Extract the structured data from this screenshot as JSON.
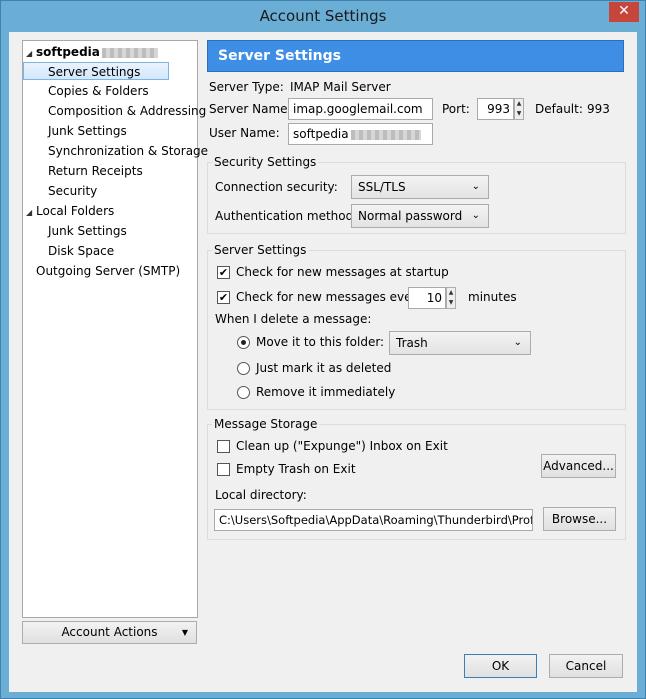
{
  "window": {
    "title": "Account Settings",
    "close_glyph": "✕"
  },
  "tree": {
    "account_name": "softpedia",
    "account_children": [
      "Server Settings",
      "Copies & Folders",
      "Composition & Addressing",
      "Junk Settings",
      "Synchronization & Storage",
      "Return Receipts",
      "Security"
    ],
    "local_folders": "Local Folders",
    "local_children": [
      "Junk Settings",
      "Disk Space"
    ],
    "outgoing": "Outgoing Server (SMTP)"
  },
  "account_actions": {
    "label": "Account Actions",
    "caret": "▼"
  },
  "header": {
    "title": "Server Settings"
  },
  "server": {
    "type_label": "Server Type:",
    "type_value": "IMAP Mail Server",
    "name_label": "Server Name:",
    "name_value": "imap.googlemail.com",
    "port_label": "Port:",
    "port_value": "993",
    "default_label": "Default:",
    "default_value": "993",
    "user_label": "User Name:",
    "user_value": "softpedia"
  },
  "security": {
    "title": "Security Settings",
    "connection_label": "Connection security:",
    "connection_value": "SSL/TLS",
    "auth_label": "Authentication method:",
    "auth_value": "Normal password"
  },
  "server_settings": {
    "title": "Server Settings",
    "check_startup": "Check for new messages at startup",
    "check_every": "Check for new messages every",
    "minutes_value": "10",
    "minutes_label": "minutes",
    "delete_label": "When I delete a message:",
    "move_label": "Move it to this folder:",
    "folder_value": "Trash",
    "mark_label": "Just mark it as deleted",
    "remove_label": "Remove it immediately"
  },
  "storage": {
    "title": "Message Storage",
    "cleanup_label": "Clean up (\"Expunge\") Inbox on Exit",
    "empty_trash_label": "Empty Trash on Exit",
    "advanced_button": "Advanced...",
    "local_dir_label": "Local directory:",
    "local_dir_value": "C:\\Users\\Softpedia\\AppData\\Roaming\\Thunderbird\\Profile",
    "browse_button": "Browse..."
  },
  "footer": {
    "ok": "OK",
    "cancel": "Cancel"
  },
  "checks": {
    "mark": "✔"
  }
}
